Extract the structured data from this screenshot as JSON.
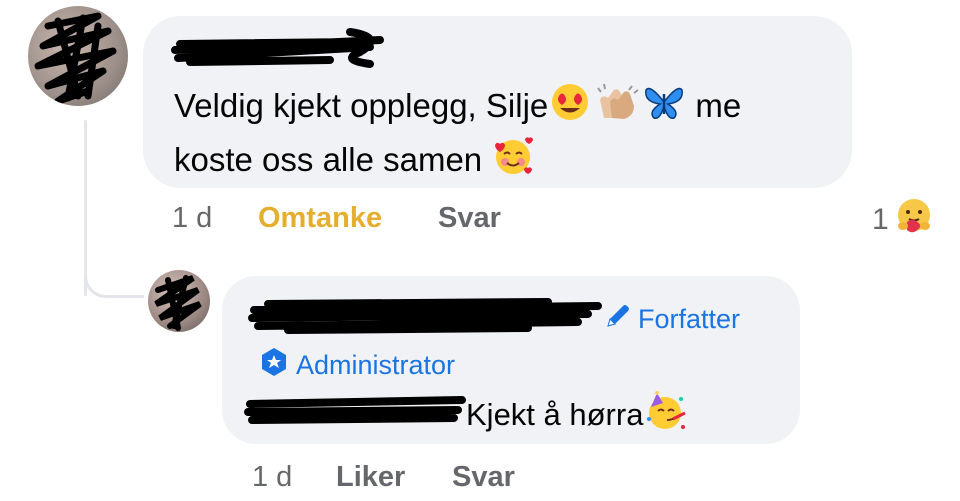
{
  "comment": {
    "text_line1": "Veldig kjekt opplegg, Silje",
    "text_after_emoji": "me",
    "text_line2": "koste oss alle samen",
    "time": "1 d",
    "reaction_label": "Omtanke",
    "reply_label": "Svar",
    "reaction_count": "1",
    "emojis": [
      "heart-eyes-emoji",
      "clapping-hands-emoji",
      "blue-butterfly-emoji",
      "smiling-face-with-hearts-emoji"
    ],
    "reaction_emoji": "care-hug-emoji"
  },
  "reply": {
    "author_badge": "Forfatter",
    "role_badge": "Administrator",
    "text": "Kjekt å hørra",
    "emoji": "partying-face-emoji",
    "time": "1 d",
    "like_label": "Liker",
    "reply_label": "Svar"
  },
  "colors": {
    "bubble": "#f0f2f5",
    "secondary_text": "#65676b",
    "badge_blue": "#1b74e4",
    "care_reaction": "#e6ae2e"
  }
}
